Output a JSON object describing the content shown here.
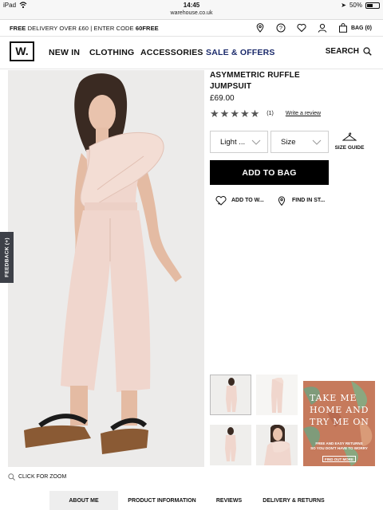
{
  "status_bar": {
    "device": "iPad",
    "time": "14:45",
    "battery": "50%",
    "url": "warehouse.co.uk"
  },
  "promo_strip": {
    "text_bold_1": "FREE",
    "text_1": " DELIVERY OVER £60 | ENTER CODE ",
    "text_bold_2": "60FREE",
    "bag_label": "BAG (0)",
    "icons": [
      "location-pin-icon",
      "help-icon",
      "heart-icon",
      "account-icon",
      "bag-icon"
    ]
  },
  "nav": {
    "logo": "W.",
    "items": [
      "NEW IN",
      "CLOTHING",
      "ACCESSORIES",
      "SALE & OFFERS"
    ],
    "search_label": "SEARCH",
    "sale_color": "#1b2a6b"
  },
  "feedback": {
    "label": "FEEDBACK (+)"
  },
  "product": {
    "title": "ASYMMETRIC RUFFLE JUMPSUIT",
    "price": "£69.00",
    "rating_stars": 5,
    "rating_count": "(1)",
    "write_review": "Write a review",
    "colour_select": "Light ...",
    "size_select": "Size",
    "size_guide": "SIZE GUIDE",
    "add_to_bag": "ADD TO BAG",
    "add_to_wishlist": "ADD TO W...",
    "find_in_store": "FIND IN ST...",
    "zoom_hint": "CLICK FOR ZOOM",
    "main_colour": "#f0d6cd"
  },
  "promo_card": {
    "headline_lines": [
      "TAKE  ME",
      "HOME AND",
      "TRY ME ON"
    ],
    "sub_lines": [
      "FREE AND EASY RETURNS",
      "SO YOU DON'T HAVE TO WORRY"
    ],
    "cta": "FIND OUT MORE"
  },
  "tabs": [
    "ABOUT ME",
    "PRODUCT INFORMATION",
    "REVIEWS",
    "DELIVERY & RETURNS"
  ]
}
